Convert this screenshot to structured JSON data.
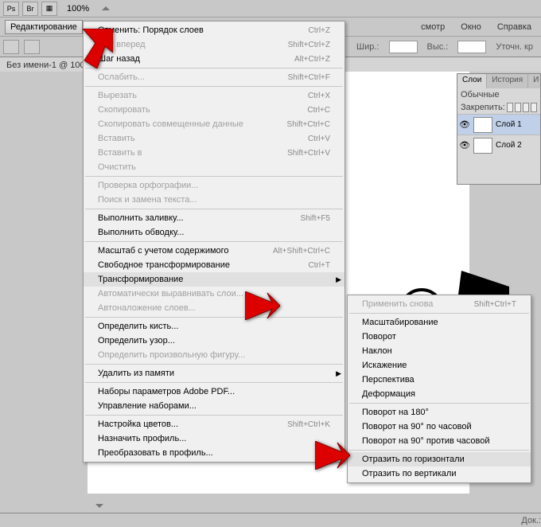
{
  "toolbar": {
    "zoom": "100%",
    "br_label": "Br"
  },
  "menubar_button": "Редактирование",
  "top_menu": {
    "view": "смотр",
    "window": "Окно",
    "help": "Справка"
  },
  "options": {
    "width_lbl": "Шир.:",
    "height_lbl": "Выс.:",
    "refine": "Уточн. кр"
  },
  "doc_tab": "Без имени-1 @ 100",
  "status": {
    "doc": "Док.:"
  },
  "menu_main": [
    {
      "label": "Отменить: Порядок слоев",
      "shortcut": "Ctrl+Z",
      "type": "item"
    },
    {
      "label": "Шаг вперед",
      "shortcut": "Shift+Ctrl+Z",
      "type": "item",
      "disabled": true
    },
    {
      "label": "Шаг назад",
      "shortcut": "Alt+Ctrl+Z",
      "type": "item"
    },
    {
      "type": "sep"
    },
    {
      "label": "Ослабить...",
      "shortcut": "Shift+Ctrl+F",
      "type": "item",
      "disabled": true
    },
    {
      "type": "sep"
    },
    {
      "label": "Вырезать",
      "shortcut": "Ctrl+X",
      "type": "item",
      "disabled": true
    },
    {
      "label": "Скопировать",
      "shortcut": "Ctrl+C",
      "type": "item",
      "disabled": true
    },
    {
      "label": "Скопировать совмещенные данные",
      "shortcut": "Shift+Ctrl+C",
      "type": "item",
      "disabled": true
    },
    {
      "label": "Вставить",
      "shortcut": "Ctrl+V",
      "type": "item",
      "disabled": true
    },
    {
      "label": "Вставить в",
      "shortcut": "Shift+Ctrl+V",
      "type": "item",
      "disabled": true
    },
    {
      "label": "Очистить",
      "shortcut": "",
      "type": "item",
      "disabled": true
    },
    {
      "type": "sep"
    },
    {
      "label": "Проверка орфографии...",
      "shortcut": "",
      "type": "item",
      "disabled": true
    },
    {
      "label": "Поиск и замена текста...",
      "shortcut": "",
      "type": "item",
      "disabled": true
    },
    {
      "type": "sep"
    },
    {
      "label": "Выполнить заливку...",
      "shortcut": "Shift+F5",
      "type": "item"
    },
    {
      "label": "Выполнить обводку...",
      "shortcut": "",
      "type": "item"
    },
    {
      "type": "sep"
    },
    {
      "label": "Масштаб с учетом содержимого",
      "shortcut": "Alt+Shift+Ctrl+C",
      "type": "item"
    },
    {
      "label": "Свободное трансформирование",
      "shortcut": "Ctrl+T",
      "type": "item"
    },
    {
      "label": "Трансформирование",
      "shortcut": "",
      "type": "item",
      "hover": true,
      "sub": true
    },
    {
      "label": "Автоматически выравнивать слои...",
      "shortcut": "",
      "type": "item",
      "disabled": true
    },
    {
      "label": "Автоналожение слоев...",
      "shortcut": "",
      "type": "item",
      "disabled": true
    },
    {
      "type": "sep"
    },
    {
      "label": "Определить кисть...",
      "shortcut": "",
      "type": "item"
    },
    {
      "label": "Определить узор...",
      "shortcut": "",
      "type": "item"
    },
    {
      "label": "Определить произвольную фигуру...",
      "shortcut": "",
      "type": "item",
      "disabled": true
    },
    {
      "type": "sep"
    },
    {
      "label": "Удалить из памяти",
      "shortcut": "",
      "type": "item",
      "sub": true
    },
    {
      "type": "sep"
    },
    {
      "label": "Наборы параметров Adobe PDF...",
      "shortcut": "",
      "type": "item"
    },
    {
      "label": "Управление наборами...",
      "shortcut": "",
      "type": "item"
    },
    {
      "type": "sep"
    },
    {
      "label": "Настройка цветов...",
      "shortcut": "Shift+Ctrl+K",
      "type": "item"
    },
    {
      "label": "Назначить профиль...",
      "shortcut": "",
      "type": "item"
    },
    {
      "label": "Преобразовать в профиль...",
      "shortcut": "",
      "type": "item"
    }
  ],
  "menu_sub": [
    {
      "label": "Применить снова",
      "shortcut": "Shift+Ctrl+T",
      "type": "item",
      "disabled": true
    },
    {
      "type": "sep"
    },
    {
      "label": "Масштабирование",
      "type": "item"
    },
    {
      "label": "Поворот",
      "type": "item"
    },
    {
      "label": "Наклон",
      "type": "item"
    },
    {
      "label": "Искажение",
      "type": "item"
    },
    {
      "label": "Перспектива",
      "type": "item"
    },
    {
      "label": "Деформация",
      "type": "item"
    },
    {
      "type": "sep"
    },
    {
      "label": "Поворот на 180°",
      "type": "item"
    },
    {
      "label": "Поворот на 90° по часовой",
      "type": "item"
    },
    {
      "label": "Поворот на 90° против часовой",
      "type": "item"
    },
    {
      "type": "sep"
    },
    {
      "label": "Отразить по горизонтали",
      "type": "item",
      "hover": true
    },
    {
      "label": "Отразить по вертикали",
      "type": "item"
    }
  ],
  "layers_panel": {
    "tabs": {
      "layers": "Слои",
      "history": "История",
      "actions": "И"
    },
    "blend": "Обычные",
    "lock": "Закрепить:",
    "layers": [
      {
        "name": "Слой 1"
      },
      {
        "name": "Слой 2"
      }
    ]
  }
}
